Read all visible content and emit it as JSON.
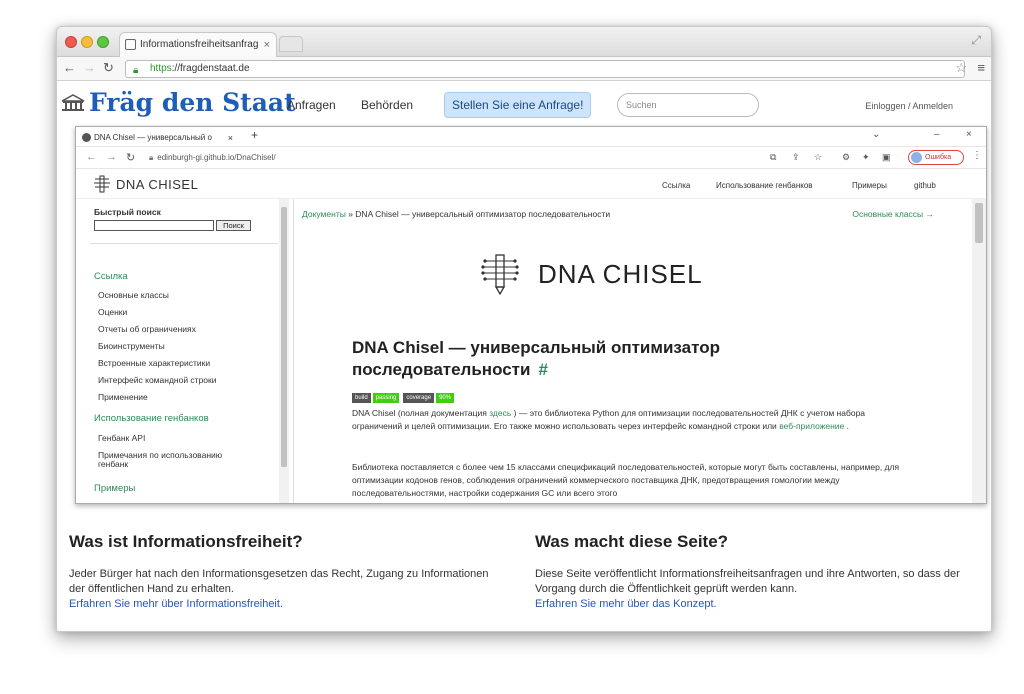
{
  "browser": {
    "tab_title": "Informationsfreiheitsanfrag",
    "url_scheme": "https",
    "url_rest": "://fragdenstaat.de"
  },
  "site": {
    "logo": "Fräg den Staat",
    "nav": [
      "Anfragen",
      "Behörden"
    ],
    "cta": "Stellen Sie eine Anfrage!",
    "search_placeholder": "Suchen",
    "login": "Einloggen / Anmelden"
  },
  "embedded": {
    "tab_title": "DNA Chisel — универсальный о",
    "url": "edinburgh-gi.github.io/DnaChisel/",
    "error_label": "Ошибка",
    "docs_logo": "DNA CHISEL",
    "top_links": [
      "Ссылка",
      "Использование генбанков",
      "Примеры",
      "github"
    ],
    "quick_search_title": "Быстрый поиск",
    "search_button": "Поиск",
    "sidebar": {
      "section1": "Ссылка",
      "items1": [
        "Основные классы",
        "Оценки",
        "Отчеты об ограничениях",
        "Биоинструменты",
        "Встроенные характеристики",
        "Интерфейс командной строки",
        "Применение"
      ],
      "section2": "Использование генбанков",
      "items2": [
        "Генбанк API",
        "Примечания по использованию",
        "генбанк"
      ],
      "section3": "Примеры"
    },
    "breadcrumb_link": "Документы",
    "breadcrumb_rest": "» DNA Chisel — универсальный оптимизатор последовательности",
    "next_link": "Основные классы →",
    "hero": "DNA CHISEL",
    "heading": "DNA Chisel — универсальный оптимизатор последовательности",
    "heading_hash": "#",
    "badges": [
      {
        "label": "build",
        "value": "passing",
        "color": "#4c1"
      },
      {
        "label": "coverage",
        "value": "90%",
        "color": "#4c1"
      }
    ],
    "para1_a": "DNA Chisel (полная документация",
    "para1_link1": "здесь",
    "para1_b": ") — это библиотека Python для оптимизации последовательностей ДНК с учетом набора ограничений и целей оптимизации. Его также можно использовать через интерфейс командной строки или",
    "para1_link2": "веб-приложение",
    "para1_c": ".",
    "para2": "Библиотека поставляется с более чем 15 классами спецификаций последовательностей, которые могут быть составлены, например, для оптимизации кодонов генов, соблюдения ограничений коммерческого поставщика ДНК, предотвращения гомологии между последовательностями, настройки содержания GC или всего этого"
  },
  "info": {
    "left_title": "Was ist Informationsfreiheit?",
    "left_text": "Jeder Bürger hat nach den Informationsgesetzen das Recht, Zugang zu Informationen der öffentlichen Hand zu erhalten.",
    "left_link": "Erfahren Sie mehr über Informationsfreiheit.",
    "right_title": "Was macht diese Seite?",
    "right_text": "Diese Seite veröffentlicht Informationsfreiheitsanfragen und ihre Antworten, so dass der Vorgang durch die Öffentlichkeit geprüft werden kann.",
    "right_link": "Erfahren Sie mehr über das Konzept."
  },
  "colors": {
    "brand": "#1f5eb8",
    "docs_green": "#2e8b57",
    "link_blue": "#2855b5"
  }
}
